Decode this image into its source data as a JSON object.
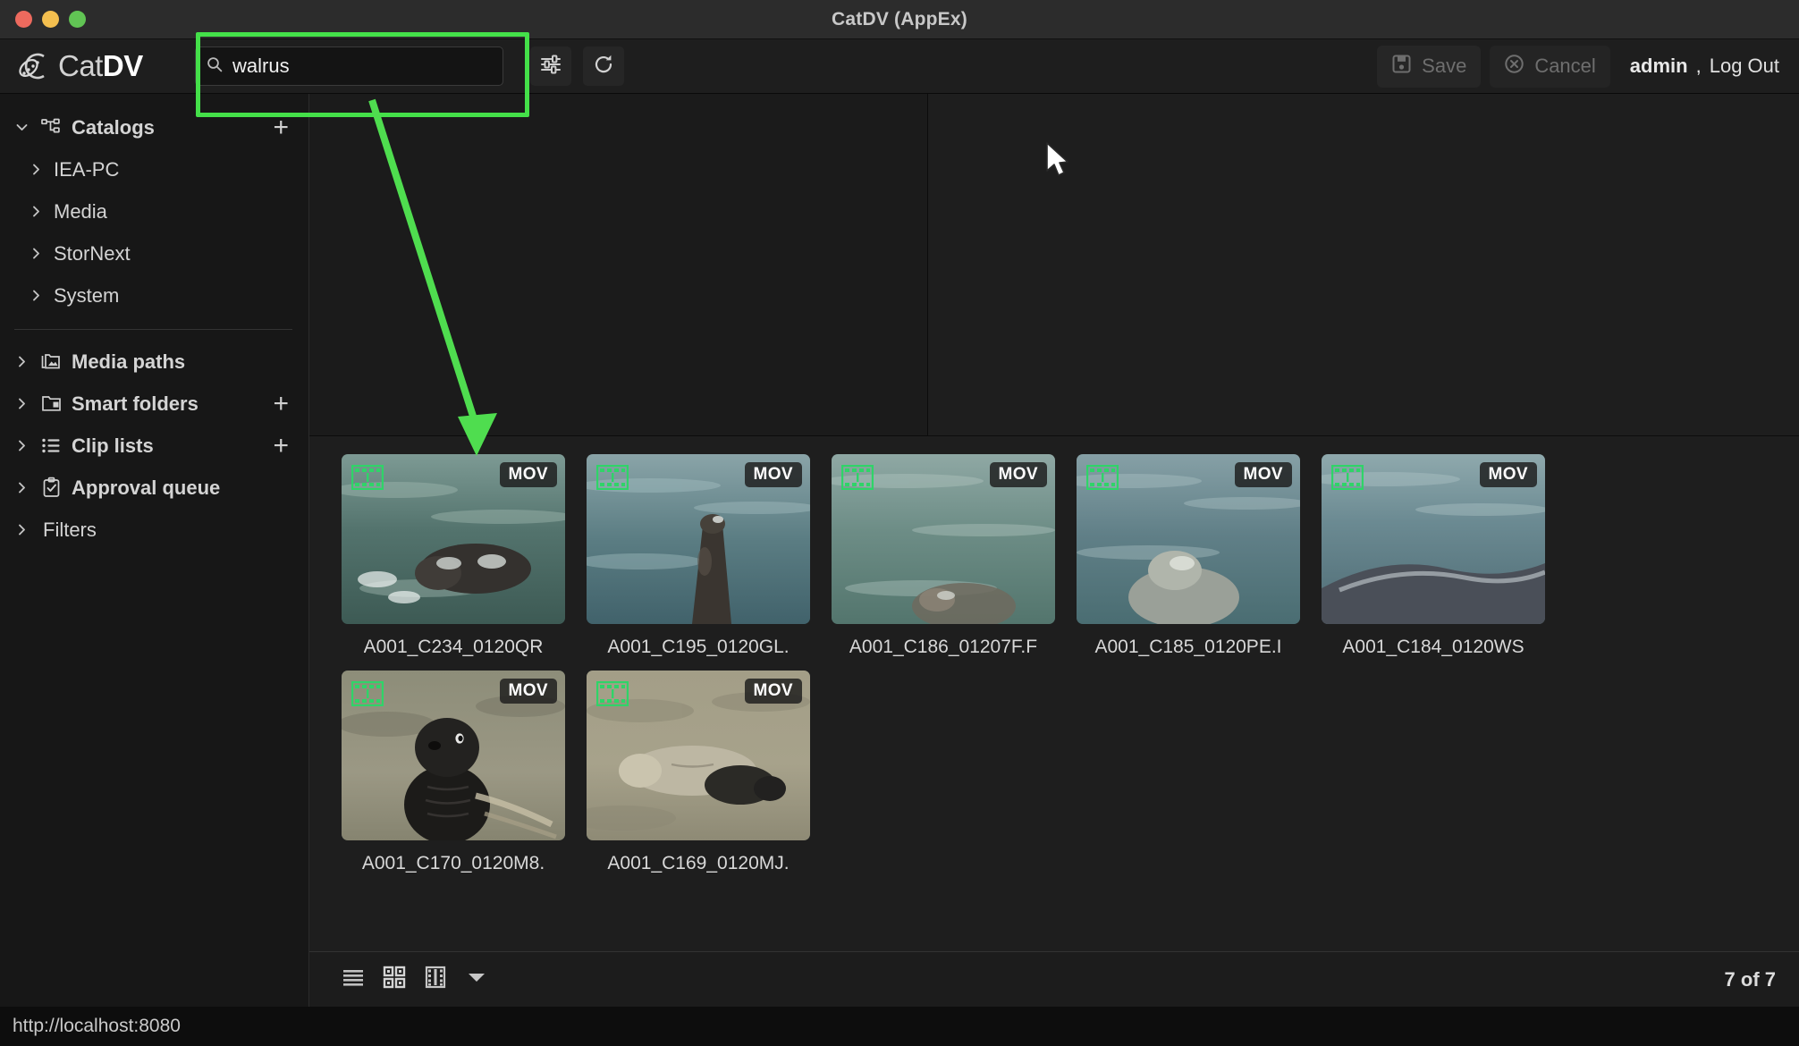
{
  "window": {
    "title": "CatDV (AppEx)",
    "traffic_lights": [
      "close",
      "minimize",
      "zoom"
    ]
  },
  "header": {
    "logo_text_light": "Cat",
    "logo_text_bold": "DV",
    "search": {
      "value": "walrus",
      "placeholder": "",
      "icon": "search-icon"
    },
    "filter_icon": "sliders-icon",
    "refresh_icon": "refresh-icon",
    "save_label": "Save",
    "save_icon": "floppy-disk-icon",
    "cancel_label": "Cancel",
    "cancel_icon": "circle-x-icon",
    "user": "admin",
    "separator": ",",
    "logout_label": "Log Out"
  },
  "sidebar": {
    "sections": [
      {
        "label": "Catalogs",
        "icon": "catalogs-icon",
        "expanded": true,
        "chevron": "chevron-down",
        "has_add": true,
        "children": [
          {
            "label": "IEA-PC",
            "chevron": "chevron-right"
          },
          {
            "label": "Media",
            "chevron": "chevron-right"
          },
          {
            "label": "StorNext",
            "chevron": "chevron-right"
          },
          {
            "label": "System",
            "chevron": "chevron-right"
          }
        ]
      },
      {
        "label": "Media paths",
        "icon": "media-paths-icon",
        "expanded": false,
        "chevron": "chevron-right",
        "has_add": false,
        "children": []
      },
      {
        "label": "Smart folders",
        "icon": "smart-folder-icon",
        "expanded": false,
        "chevron": "chevron-right",
        "has_add": true,
        "children": []
      },
      {
        "label": "Clip lists",
        "icon": "list-icon",
        "expanded": false,
        "chevron": "chevron-right",
        "has_add": true,
        "children": []
      },
      {
        "label": "Approval queue",
        "icon": "clipboard-check-icon",
        "expanded": false,
        "chevron": "chevron-right",
        "has_add": false,
        "children": []
      },
      {
        "label": "Filters",
        "icon": "",
        "expanded": false,
        "chevron": "chevron-right",
        "has_add": false,
        "children": []
      }
    ],
    "add_symbol": "+"
  },
  "results": {
    "items": [
      {
        "label": "A001_C234_0120QR",
        "badge": "MOV",
        "scene": "water",
        "tone": "#5c7a74"
      },
      {
        "label": "A001_C195_0120GL.",
        "badge": "MOV",
        "scene": "water",
        "tone": "#4f7078"
      },
      {
        "label": "A001_C186_01207F.F",
        "badge": "MOV",
        "scene": "water",
        "tone": "#5e7f80"
      },
      {
        "label": "A001_C185_0120PE.I",
        "badge": "MOV",
        "scene": "water",
        "tone": "#597579"
      },
      {
        "label": "A001_C184_0120WS",
        "badge": "MOV",
        "scene": "water",
        "tone": "#5a7582"
      },
      {
        "label": "A001_C170_0120M8.",
        "badge": "MOV",
        "scene": "sand",
        "tone": "#8d8a76"
      },
      {
        "label": "A001_C169_0120MJ.",
        "badge": "MOV",
        "scene": "sand",
        "tone": "#97927c"
      }
    ],
    "count_text": "7 of 7"
  },
  "bottombar": {
    "view_modes": [
      {
        "name": "list-view-icon",
        "active": false
      },
      {
        "name": "grid-view-icon",
        "active": true
      },
      {
        "name": "filmstrip-view-icon",
        "active": false
      },
      {
        "name": "chevron-down-icon",
        "active": false
      }
    ]
  },
  "statusbar": {
    "url": "http://localhost:8080"
  },
  "annotations": {
    "highlight_color": "#44e049",
    "arrow_color": "#4fdd4f"
  }
}
